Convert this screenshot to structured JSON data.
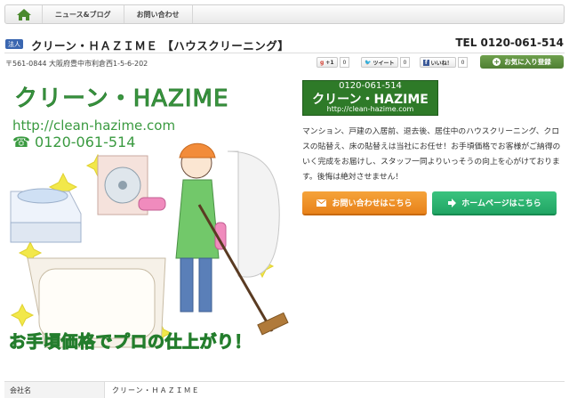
{
  "nav": {
    "home_icon": "home-icon",
    "items": [
      {
        "label": "ニュース&ブログ"
      },
      {
        "label": "お問い合わせ"
      }
    ]
  },
  "header": {
    "badge": "法人",
    "title": "クリーン・ＨＡＺＩＭＥ 【ハウスクリーニング】",
    "tel": "TEL 0120-061-514",
    "address": "〒561-0844 大阪府豊中市利倉西1-5-6-202"
  },
  "social": {
    "gplus": {
      "label": "+1",
      "count": "0"
    },
    "tweet": {
      "label": "ツイート",
      "count": "0"
    },
    "like": {
      "label": "いいね！",
      "count": "0"
    },
    "favorite_label": "お気に入り登録"
  },
  "hero": {
    "name": "クリーン・HAZIME",
    "url": "http://clean-hazime.com",
    "tel": "0120-061-514",
    "slogan": "お手頃価格でプロの仕上がり！"
  },
  "logo": {
    "tel": "0120-061-514",
    "name": "クリーン・HAZIME",
    "url": "http://clean-hazime.com"
  },
  "description": "マンション、戸建の入居前、退去後、居住中のハウスクリーニング、クロスの貼替え、床の貼替えは当社にお任せ！お手頃価格でお客様がご納得のいく完成をお届けし、スタッフ一同よりいっそうの向上を心がけております。後悔は絶対させません！",
  "buttons": {
    "contact": "お問い合わせはこちら",
    "homepage": "ホームページはこちら"
  },
  "info": {
    "label": "会社名",
    "value": "クリーン・ＨＡＺＩＭＥ"
  },
  "colors": {
    "accent_green": "#3a9a40",
    "contact_orange": "#e8821a",
    "homepage_green": "#21a564",
    "badge_blue": "#3a66b0"
  }
}
